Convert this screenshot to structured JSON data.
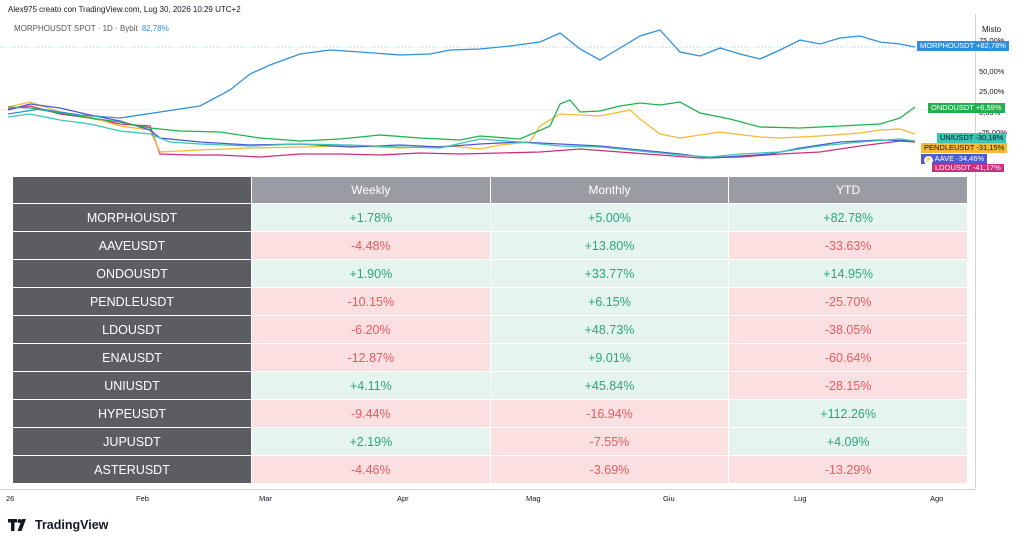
{
  "header": {
    "title": "Alex975 creato con TradingView.com, Lug 30, 2026 10:29 UTC+2"
  },
  "legend": {
    "symbol": "MORPHOUSDT SPOT · 1D · Bybit",
    "value": "82,78%"
  },
  "yaxis": {
    "title": "Misto",
    "ticks": [
      "75,00%",
      "50,00%",
      "25,00%",
      "0,00%",
      "-25,00%"
    ]
  },
  "price_tags": [
    {
      "label": "MORPHOUSDT",
      "value": "+82,78%",
      "color": "#2f8fde"
    },
    {
      "label": "ONDOUSDT",
      "value": "+6,59%",
      "color": "#22b14c"
    },
    {
      "label": "UNIUSDT",
      "value": "-30,18%",
      "color": "#3cc4b4"
    },
    {
      "label": "PENDLEUSDT",
      "value": "-31,15%",
      "color": "#f5b935"
    },
    {
      "label": "AAVE",
      "value": "-34,46%",
      "color": "#4a59d6"
    },
    {
      "label": "LDOUSDT",
      "value": "-41,17%",
      "color": "#cc2f7f"
    }
  ],
  "table": {
    "headers": [
      "Weekly",
      "Monthly",
      "YTD"
    ],
    "rows": [
      {
        "symbol": "MORPHOUSDT",
        "weekly": "+1.78%",
        "monthly": "+5.00%",
        "ytd": "+82.78%"
      },
      {
        "symbol": "AAVEUSDT",
        "weekly": "-4.48%",
        "monthly": "+13.80%",
        "ytd": "-33.63%"
      },
      {
        "symbol": "ONDOUSDT",
        "weekly": "+1.90%",
        "monthly": "+33.77%",
        "ytd": "+14.95%"
      },
      {
        "symbol": "PENDLEUSDT",
        "weekly": "-10.15%",
        "monthly": "+6.15%",
        "ytd": "-25.70%"
      },
      {
        "symbol": "LDOUSDT",
        "weekly": "-6.20%",
        "monthly": "+48.73%",
        "ytd": "-38.05%"
      },
      {
        "symbol": "ENAUSDT",
        "weekly": "-12.87%",
        "monthly": "+9.01%",
        "ytd": "-60.64%"
      },
      {
        "symbol": "UNIUSDT",
        "weekly": "+4.11%",
        "monthly": "+45.84%",
        "ytd": "-28.15%"
      },
      {
        "symbol": "HYPEUSDT",
        "weekly": "-9.44%",
        "monthly": "-16.94%",
        "ytd": "+112.26%"
      },
      {
        "symbol": "JUPUSDT",
        "weekly": "+2.19%",
        "monthly": "-7.55%",
        "ytd": "+4.09%"
      },
      {
        "symbol": "ASTERUSDT",
        "weekly": "-4.46%",
        "monthly": "-3.69%",
        "ytd": "-13.29%"
      }
    ]
  },
  "xaxis": {
    "labels": [
      "26",
      "Feb",
      "Mar",
      "Apr",
      "Mag",
      "Giu",
      "Lug",
      "Ago"
    ]
  },
  "colors": {
    "positive_bg": "#e6f4ef",
    "positive_text": "#2aa57c",
    "negative_bg": "#fbe0e1",
    "negative_text": "#e25b5f"
  },
  "brand": {
    "name": "TradingView",
    "logo_icon": "tradingview-logo-icon"
  }
}
